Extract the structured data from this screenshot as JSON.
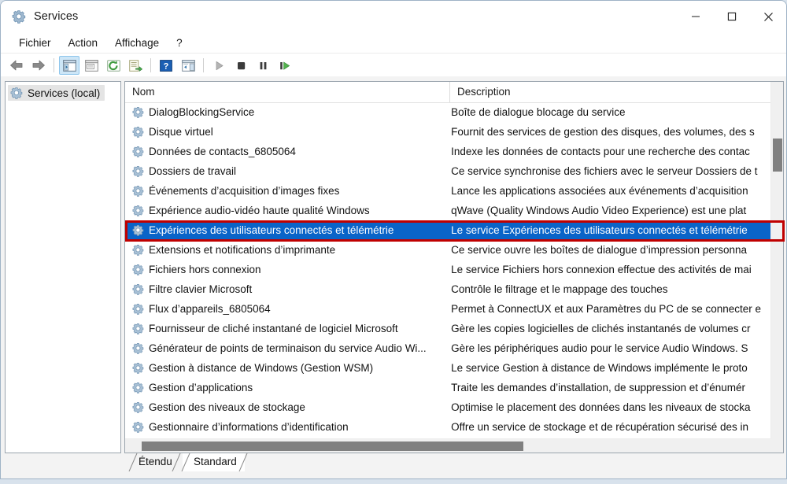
{
  "window": {
    "title": "Services",
    "icon": "services-gear-icon",
    "controls": {
      "minimize": "minimize-icon",
      "maximize": "maximize-icon",
      "close": "close-icon"
    }
  },
  "menubar": {
    "items": [
      {
        "label": "Fichier",
        "name": "menu-fichier"
      },
      {
        "label": "Action",
        "name": "menu-action"
      },
      {
        "label": "Affichage",
        "name": "menu-affichage"
      },
      {
        "label": "?",
        "name": "menu-aide"
      }
    ]
  },
  "toolbar": {
    "buttons": [
      {
        "icon": "back-arrow-icon",
        "active": false
      },
      {
        "icon": "forward-arrow-icon",
        "active": false
      },
      {
        "icon": "show-console-tree-icon",
        "active": true
      },
      {
        "icon": "properties-icon",
        "active": false
      },
      {
        "icon": "refresh-icon",
        "active": false
      },
      {
        "icon": "export-list-icon",
        "active": false
      },
      {
        "icon": "help-icon",
        "active": false
      },
      {
        "icon": "show-hide-action-pane-icon",
        "active": false
      },
      {
        "icon": "start-service-icon",
        "active": false
      },
      {
        "icon": "stop-service-icon",
        "active": false
      },
      {
        "icon": "pause-service-icon",
        "active": false
      },
      {
        "icon": "restart-service-icon",
        "active": false
      }
    ]
  },
  "tree": {
    "node_label": "Services (local)",
    "node_icon": "services-gear-icon"
  },
  "list": {
    "columns": [
      {
        "label": "Nom",
        "key": "name"
      },
      {
        "label": "Description",
        "key": "description"
      }
    ],
    "sort_indicator": "sort-ascending-icon",
    "rows": [
      {
        "name": "DialogBlockingService",
        "description": "Boîte de dialogue blocage du service",
        "selected": false
      },
      {
        "name": "Disque virtuel",
        "description": "Fournit des services de gestion des disques, des volumes, des s",
        "selected": false
      },
      {
        "name": "Données de contacts_6805064",
        "description": "Indexe les données de contacts pour une recherche des contac",
        "selected": false
      },
      {
        "name": "Dossiers de travail",
        "description": "Ce service synchronise des fichiers avec le serveur Dossiers de t",
        "selected": false
      },
      {
        "name": "Événements d’acquisition d’images fixes",
        "description": "Lance les applications associées aux événements d’acquisition",
        "selected": false
      },
      {
        "name": "Expérience audio-vidéo haute qualité Windows",
        "description": "qWave (Quality Windows Audio Video Experience) est une plat",
        "selected": false
      },
      {
        "name": "Expériences des utilisateurs connectés et télémétrie",
        "description": "Le service Expériences des utilisateurs connectés et télémétrie ",
        "selected": true
      },
      {
        "name": "Extensions et notifications d’imprimante",
        "description": "Ce service ouvre les boîtes de dialogue d’impression personna",
        "selected": false
      },
      {
        "name": "Fichiers hors connexion",
        "description": "Le service Fichiers hors connexion effectue des activités de mai",
        "selected": false
      },
      {
        "name": "Filtre clavier Microsoft",
        "description": "Contrôle le filtrage et le mappage des touches",
        "selected": false
      },
      {
        "name": "Flux d’appareils_6805064",
        "description": "Permet à ConnectUX et aux Paramètres du PC de se connecter e",
        "selected": false
      },
      {
        "name": "Fournisseur de cliché instantané de logiciel Microsoft",
        "description": "Gère les copies logicielles de clichés instantanés de volumes cr",
        "selected": false
      },
      {
        "name": "Générateur de points de terminaison du service Audio Wi...",
        "description": "Gère les périphériques audio pour le service Audio Windows. S",
        "selected": false
      },
      {
        "name": "Gestion à distance de Windows (Gestion WSM)",
        "description": "Le service Gestion à distance de Windows implémente le proto",
        "selected": false
      },
      {
        "name": "Gestion d’applications",
        "description": "Traite les demandes d’installation, de suppression et d’énumér",
        "selected": false
      },
      {
        "name": "Gestion des niveaux de stockage",
        "description": "Optimise le placement des données dans les niveaux de stocka",
        "selected": false
      },
      {
        "name": "Gestionnaire d’informations d’identification",
        "description": "Offre un service de stockage et de récupération sécurisé des in",
        "selected": false
      }
    ],
    "row_icon": "service-gear-icon"
  },
  "tabs": [
    {
      "label": "Étendu",
      "active": false,
      "name": "tab-etendu"
    },
    {
      "label": "Standard",
      "active": true,
      "name": "tab-standard"
    }
  ],
  "annotation": {
    "highlight_color": "#c00000",
    "highlight_target": "Expériences des utilisateurs connectés et télémétrie"
  },
  "colors": {
    "selection_blue": "#0a64c8",
    "window_chrome": "#f3f3f3",
    "pane_border": "#9aa4ad",
    "scrollbar_thumb": "#808080"
  }
}
